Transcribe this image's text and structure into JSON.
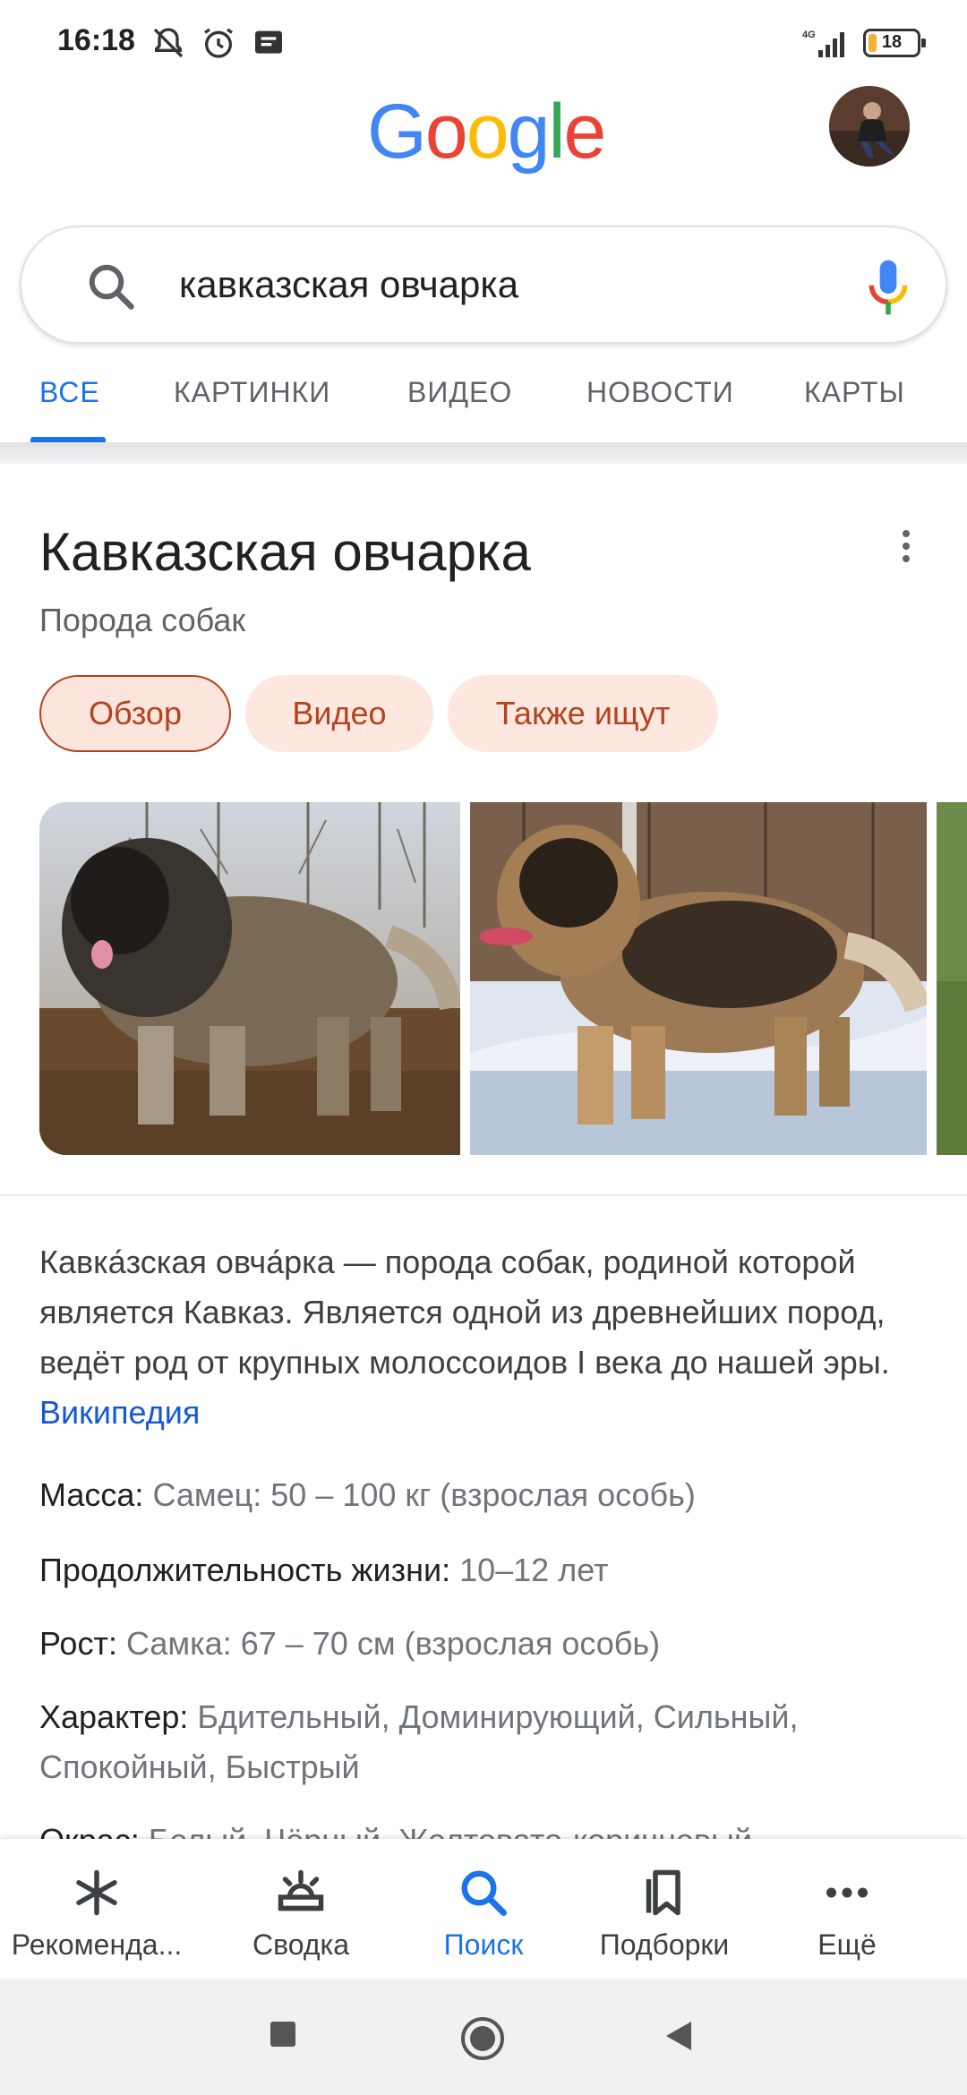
{
  "status": {
    "time": "16:18",
    "network": "4G",
    "battery": "18",
    "battery_level": 0.18
  },
  "header": {
    "logo": "Google"
  },
  "search": {
    "query": "кавказская овчарка"
  },
  "tabs": [
    {
      "label": "ВСЕ",
      "active": true
    },
    {
      "label": "КАРТИНКИ"
    },
    {
      "label": "ВИДЕО"
    },
    {
      "label": "НОВОСТИ"
    },
    {
      "label": "КАРТЫ"
    }
  ],
  "panel": {
    "title": "Кавказская овчарка",
    "subtitle": "Порода собак",
    "chips": [
      "Обзор",
      "Видео",
      "Также ищут"
    ],
    "description": "Кавка́зская овча́рка — порода собак, родиной которой является Кавказ. Является одной из древнейших пород, ведёт род от крупных молоссоидов I века до нашей эры.",
    "source_link": "Википедия",
    "facts": [
      {
        "label": "Масса:",
        "value": "Самец: 50 – 100 кг (взрослая особь)"
      },
      {
        "label": "Продолжительность жизни:",
        "value": "10–12 лет"
      },
      {
        "label": "Рост:",
        "value": "Самка: 67 – 70 см (взрослая особь)"
      },
      {
        "label": "Характер:",
        "value": "Бдительный, Доминирующий, Сильный, Спокойный, Быстрый"
      },
      {
        "label": "Окрас:",
        "value": "Белый, Чёрный, Желтовато-коричневый"
      }
    ]
  },
  "bottom_nav": [
    {
      "label": "Рекоменда...",
      "icon": "asterisk-icon"
    },
    {
      "label": "Сводка",
      "icon": "sunrise-icon"
    },
    {
      "label": "Поиск",
      "icon": "search-icon",
      "active": true
    },
    {
      "label": "Подборки",
      "icon": "bookmarks-icon"
    },
    {
      "label": "Ещё",
      "icon": "more-horizontal-icon"
    }
  ],
  "colors": {
    "accent": "#1a73e8",
    "chip_bg": "#fde7de",
    "chip_text": "#b3421e",
    "link": "#1558d6"
  }
}
